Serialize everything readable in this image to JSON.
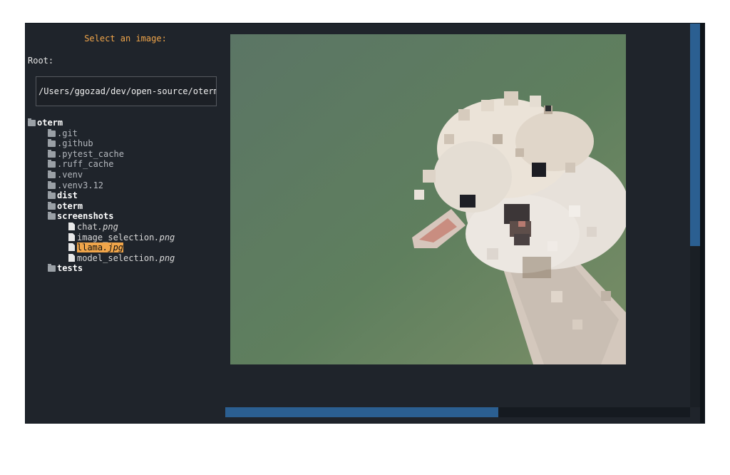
{
  "dialog": {
    "title": "Select an image:",
    "root_label": "Root:",
    "root_path": "/Users/ggozad/dev/open-source/oterm"
  },
  "tree": {
    "root": "oterm",
    "children": [
      {
        "name": ".git",
        "type": "folder"
      },
      {
        "name": ".github",
        "type": "folder"
      },
      {
        "name": ".pytest_cache",
        "type": "folder"
      },
      {
        "name": ".ruff_cache",
        "type": "folder"
      },
      {
        "name": ".venv",
        "type": "folder"
      },
      {
        "name": ".venv3.12",
        "type": "folder"
      },
      {
        "name": "dist",
        "type": "folder"
      },
      {
        "name": "oterm",
        "type": "folder"
      },
      {
        "name": "screenshots",
        "type": "folder",
        "children": [
          {
            "stem": "chat",
            "ext": ".png"
          },
          {
            "stem": "image_selection",
            "ext": ".png"
          },
          {
            "stem": "llama",
            "ext": ".jpg",
            "selected": true
          },
          {
            "stem": "model_selection",
            "ext": ".png"
          }
        ]
      },
      {
        "name": "tests",
        "type": "folder"
      }
    ]
  },
  "preview": {
    "icon": "llama-image",
    "background_colors": [
      "#5b7565",
      "#6e8a5e"
    ]
  },
  "colors": {
    "accent": "#f0a54a",
    "scrollbar": "#2b5f91",
    "background": "#1f242b"
  }
}
